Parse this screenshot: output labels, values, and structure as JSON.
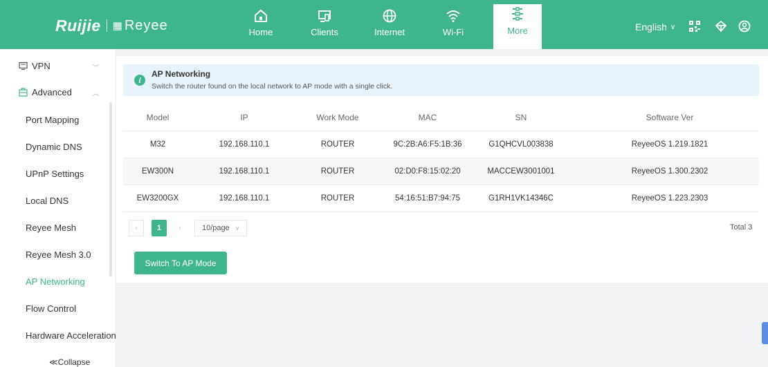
{
  "header": {
    "logo_brand": "Ruijie",
    "logo_product": "Reyee",
    "nav": [
      {
        "label": "Home",
        "icon": "home-icon"
      },
      {
        "label": "Clients",
        "icon": "clients-icon"
      },
      {
        "label": "Internet",
        "icon": "globe-icon"
      },
      {
        "label": "Wi-Fi",
        "icon": "wifi-icon"
      },
      {
        "label": "More",
        "icon": "more-icon",
        "active": true
      }
    ],
    "language": "English",
    "icons": [
      "qrcode-icon",
      "network-icon",
      "user-icon"
    ]
  },
  "sidebar": {
    "groups": [
      {
        "label": "VPN",
        "icon": "vpn-icon",
        "expanded": false
      },
      {
        "label": "Advanced",
        "icon": "advanced-icon",
        "expanded": true
      }
    ],
    "items": [
      {
        "label": "Port Mapping"
      },
      {
        "label": "Dynamic DNS"
      },
      {
        "label": "UPnP Settings"
      },
      {
        "label": "Local DNS"
      },
      {
        "label": "Reyee Mesh"
      },
      {
        "label": "Reyee Mesh 3.0"
      },
      {
        "label": "AP Networking",
        "active": true
      },
      {
        "label": "Flow Control"
      },
      {
        "label": "Hardware Acceleration"
      }
    ],
    "collapse_label": "≪Collapse"
  },
  "info": {
    "title": "AP Networking",
    "description": "Switch the router found on the local network to AP mode with a single click."
  },
  "table": {
    "columns": [
      "Model",
      "IP",
      "Work Mode",
      "MAC",
      "SN",
      "Software Ver"
    ],
    "rows": [
      [
        "M32",
        "192.168.110.1",
        "ROUTER",
        "9C:2B:A6:F5:1B:36",
        "G1QHCVL003838",
        "ReyeeOS 1.219.1821"
      ],
      [
        "EW300N",
        "192.168.110.1",
        "ROUTER",
        "02:D0:F8:15:02:20",
        "MACCEW3001001",
        "ReyeeOS 1.300.2302"
      ],
      [
        "EW3200GX",
        "192.168.110.1",
        "ROUTER",
        "54:16:51:B7:94:75",
        "G1RH1VK14346C",
        "ReyeeOS 1.223.2303"
      ]
    ]
  },
  "pagination": {
    "current_page": "1",
    "page_size": "10/page",
    "total": "Total 3"
  },
  "actions": {
    "switch_label": "Switch To AP Mode"
  },
  "colors": {
    "brand": "#3fb58d",
    "info_bg": "#e8f3fc"
  }
}
